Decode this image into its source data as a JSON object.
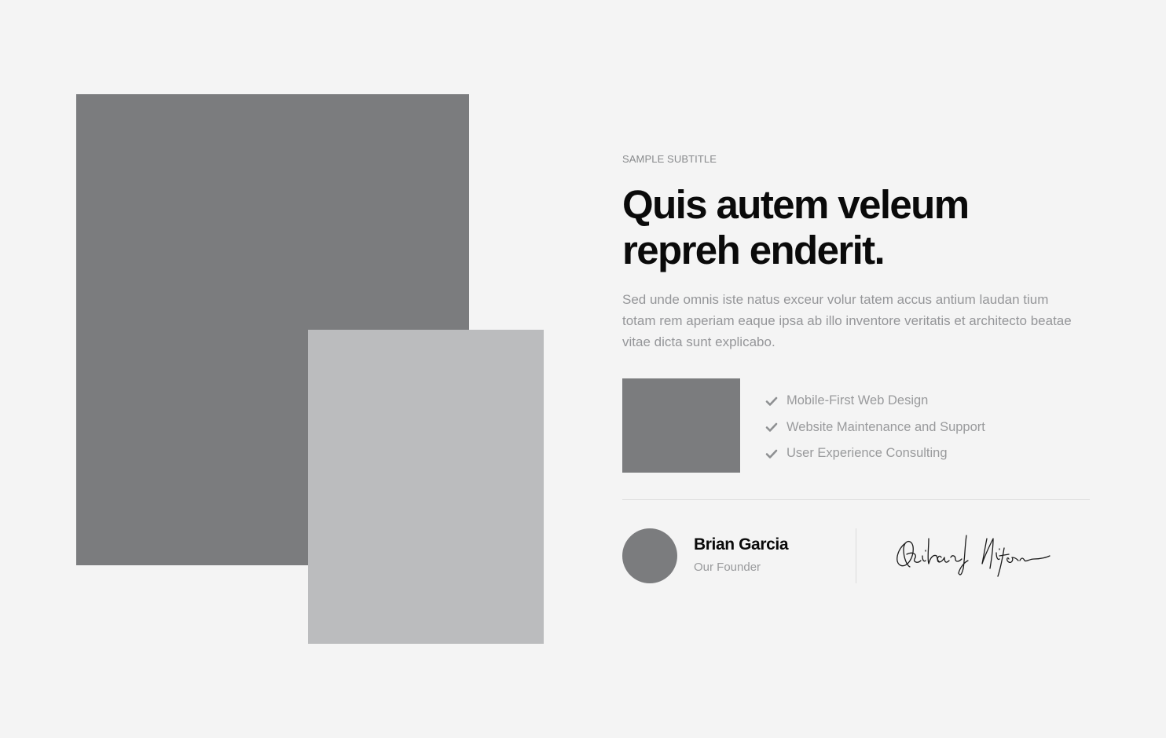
{
  "about": {
    "subtitle": "SAMPLE SUBTITLE",
    "heading": "Quis autem veleum repreh enderit.",
    "description": "Sed unde omnis iste natus exceur volur tatem accus antium laudan tium totam rem aperiam eaque ipsa ab illo inventore veritatis et architecto beatae vitae dicta sunt explicabo.",
    "features": [
      {
        "label": "Mobile-First Web Design",
        "icon": "check-icon"
      },
      {
        "label": "Website Maintenance and Support",
        "icon": "check-icon"
      },
      {
        "label": "User Experience Consulting",
        "icon": "check-icon"
      }
    ]
  },
  "founder": {
    "name": "Brian Garcia",
    "role": "Our Founder",
    "signature": "Richard Nixon"
  },
  "colors": {
    "background": "#f4f4f4",
    "placeholder_dark": "#7b7c7e",
    "placeholder_light": "#bbbcbe",
    "heading": "#0a0a0a",
    "muted_text": "#959699",
    "divider": "#dcdcdc"
  }
}
